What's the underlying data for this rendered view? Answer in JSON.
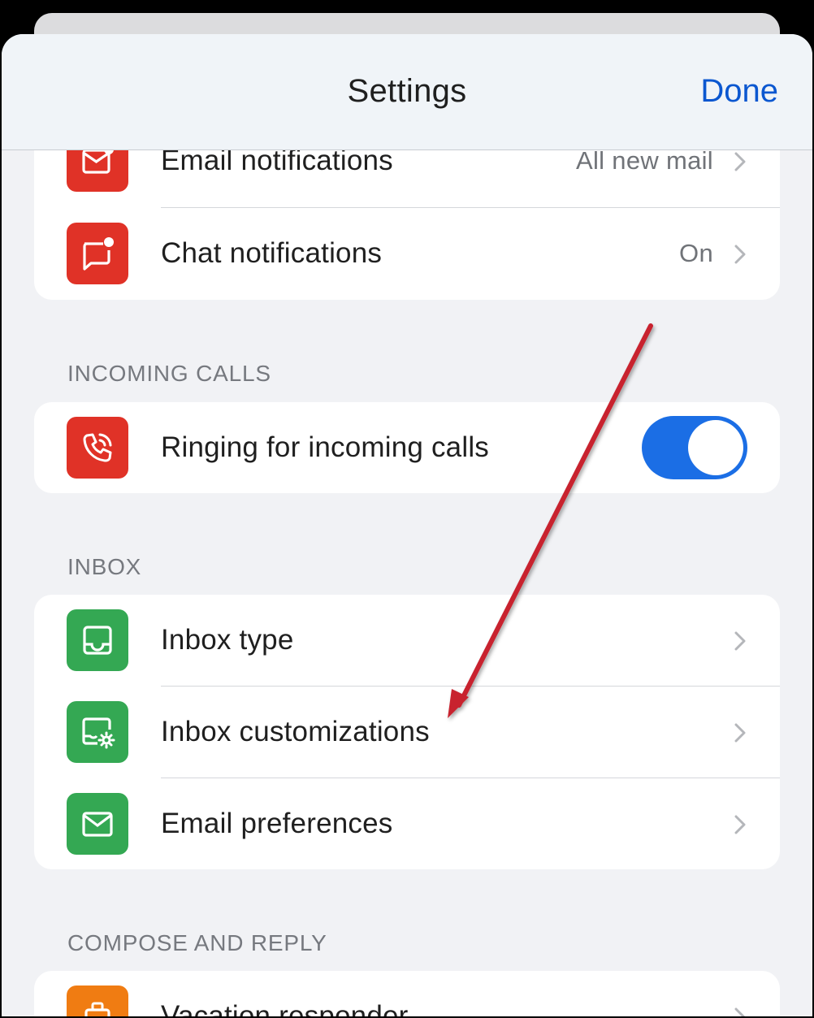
{
  "header": {
    "title": "Settings",
    "done_label": "Done"
  },
  "notifications": {
    "items": [
      {
        "label": "Email notifications",
        "value": "All new mail",
        "icon": "email-notification-icon",
        "icon_color": "#e03227"
      },
      {
        "label": "Chat notifications",
        "value": "On",
        "icon": "chat-notification-icon",
        "icon_color": "#e03227"
      }
    ]
  },
  "incoming_calls": {
    "header": "INCOMING CALLS",
    "items": [
      {
        "label": "Ringing for incoming calls",
        "icon": "phone-ringing-icon",
        "icon_color": "#e03227",
        "toggle_on": true
      }
    ]
  },
  "inbox": {
    "header": "INBOX",
    "items": [
      {
        "label": "Inbox type",
        "icon": "inbox-tray-icon",
        "icon_color": "#34a853"
      },
      {
        "label": "Inbox customizations",
        "icon": "inbox-settings-icon",
        "icon_color": "#34a853"
      },
      {
        "label": "Email preferences",
        "icon": "envelope-icon",
        "icon_color": "#34a853"
      }
    ]
  },
  "compose_reply": {
    "header": "COMPOSE AND REPLY",
    "items": [
      {
        "label": "Vacation responder",
        "icon": "suitcase-icon",
        "icon_color": "#f07c12"
      }
    ]
  },
  "colors": {
    "accent": "#0b57d0",
    "toggle_on": "#1b6ee5",
    "annotation_arrow": "#c8202f"
  }
}
